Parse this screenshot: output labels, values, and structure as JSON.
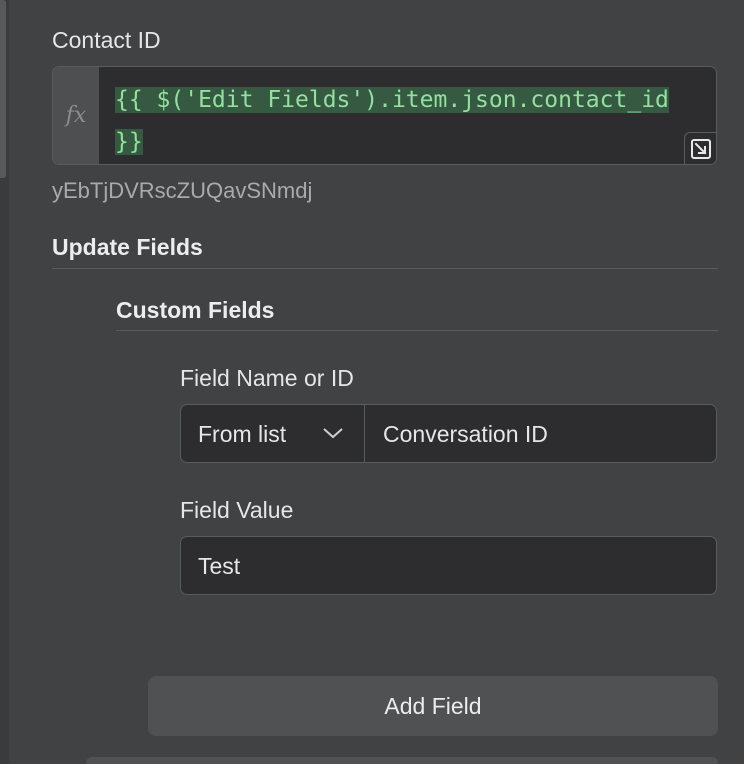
{
  "contact_id": {
    "label": "Contact ID",
    "fx_icon_text": "fx",
    "expression_line1": "{{ $('Edit Fields').item.json.contact_id",
    "expression_line2": "}}",
    "resolved_value": "yEbTjDVRscZUQavSNmdj",
    "expand_icon": "expand-icon"
  },
  "update_fields": {
    "label": "Update Fields"
  },
  "custom_fields": {
    "label": "Custom Fields",
    "field_name": {
      "label": "Field Name or ID",
      "mode": "From list",
      "value": "Conversation ID"
    },
    "field_value": {
      "label": "Field Value",
      "value": "Test"
    },
    "add_field_label": "Add Field"
  },
  "colors": {
    "panel_bg": "#414244",
    "input_bg": "#2d2d2f",
    "expression_green": "#94e0a0",
    "expression_highlight": "#355a41"
  }
}
